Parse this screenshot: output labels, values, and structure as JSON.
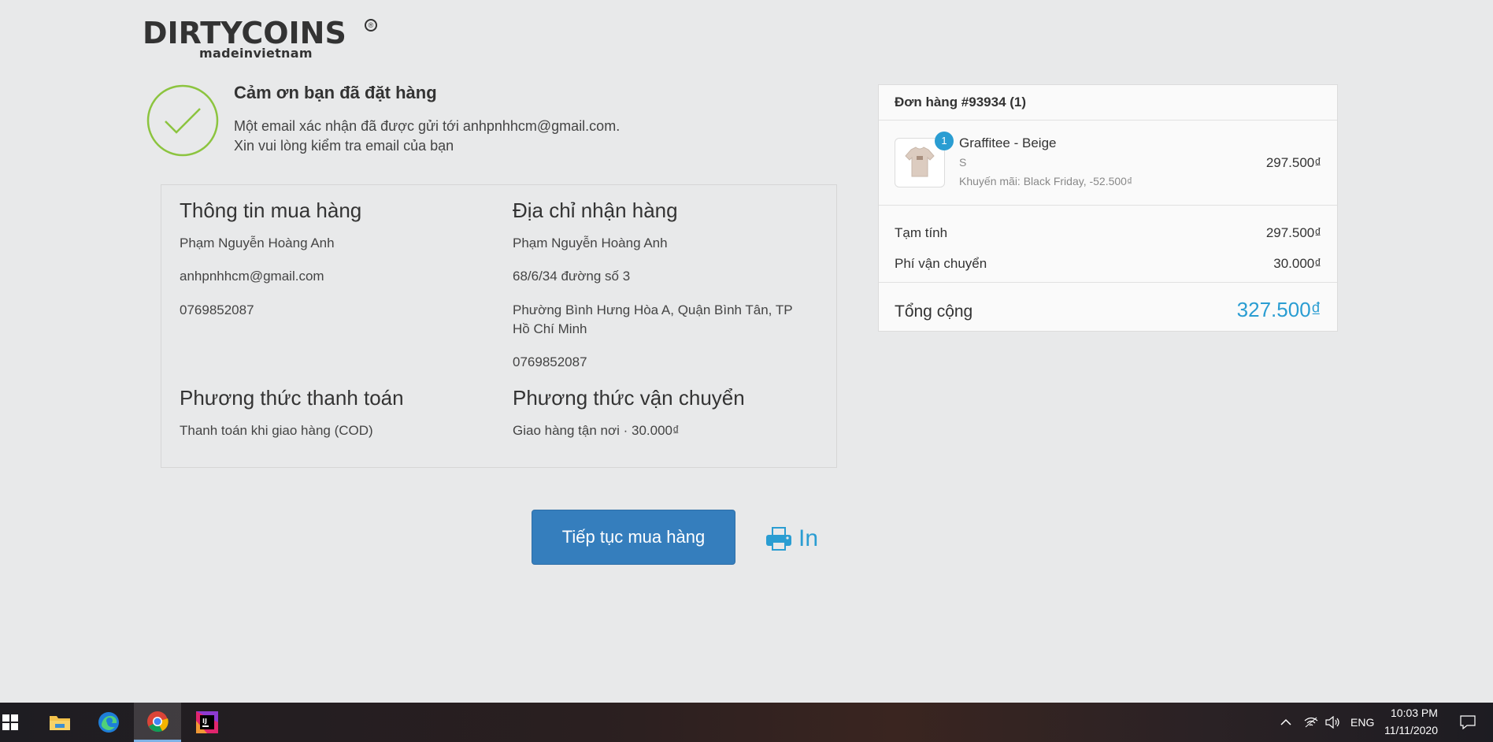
{
  "brand": {
    "name": "DIRTYCOINS",
    "tagline": "madeinvietnam",
    "reg": "®"
  },
  "confirmation": {
    "title": "Cảm ơn bạn đã đặt hàng",
    "line1": "Một email xác nhận đã được gửi tới anhpnhhcm@gmail.com.",
    "line2": "Xin vui lòng kiểm tra email của bạn"
  },
  "customer_info": {
    "heading": "Thông tin mua hàng",
    "name": "Phạm Nguyễn Hoàng Anh",
    "email": "anhpnhhcm@gmail.com",
    "phone": "0769852087"
  },
  "shipping_address": {
    "heading": "Địa chỉ nhận hàng",
    "name": "Phạm Nguyễn Hoàng Anh",
    "street": "68/6/34 đường số 3",
    "area_line1": "Phường Bình Hưng Hòa A, Quận Bình Tân, TP",
    "area_line2": "Hồ Chí Minh",
    "phone": "0769852087"
  },
  "payment": {
    "heading": "Phương thức thanh toán",
    "value": "Thanh toán khi giao hàng (COD)"
  },
  "delivery": {
    "heading": "Phương thức vận chuyển",
    "value": "Giao hàng tận nơi · 30.000₫"
  },
  "order": {
    "title": "Đơn hàng #93934 (1)",
    "item": {
      "qty": "1",
      "name": "Graffitee - Beige",
      "variant": "S",
      "promo": "Khuyến mãi: Black Friday, -52.500₫",
      "price": "297.500₫"
    },
    "subtotal_label": "Tạm tính",
    "subtotal": "297.500₫",
    "shipping_label": "Phí vận chuyển",
    "shipping": "30.000₫",
    "total_label": "Tổng cộng",
    "total": "327.500₫"
  },
  "actions": {
    "continue_label": "Tiếp tục mua hàng",
    "print_label": "In"
  },
  "taskbar": {
    "lang": "ENG",
    "time": "10:03 PM",
    "date": "11/11/2020"
  },
  "colors": {
    "accent": "#2a9dd2",
    "button": "#357ebd",
    "check": "#8cc43f"
  }
}
